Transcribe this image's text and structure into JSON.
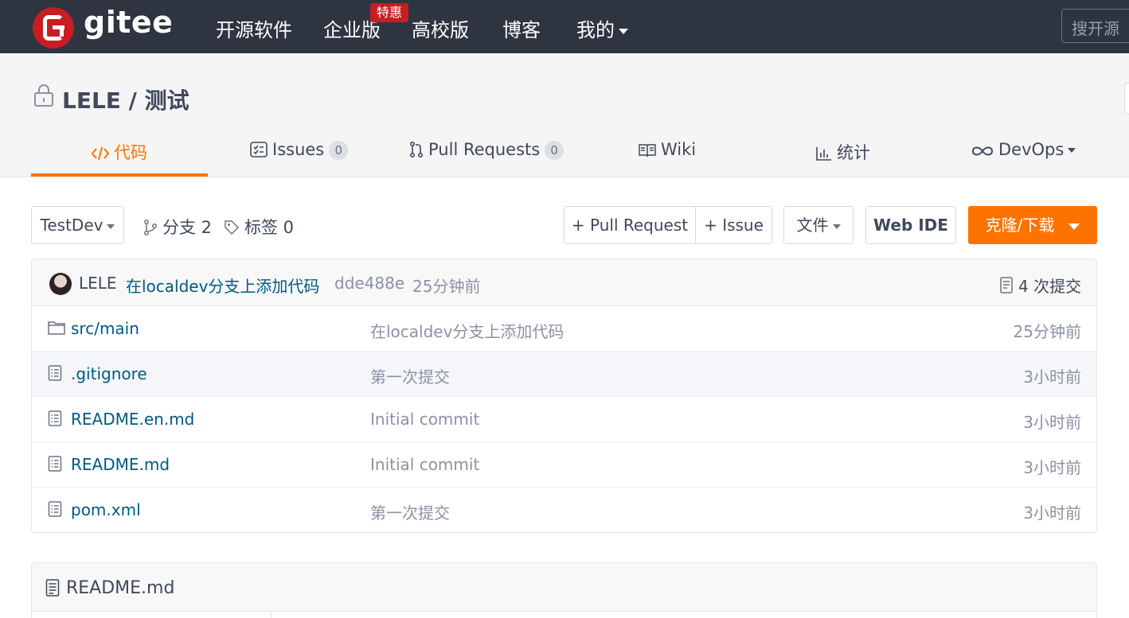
{
  "topnav": {
    "logo_text": "gitee",
    "items": [
      "开源软件",
      "企业版",
      "高校版",
      "博客",
      "我的"
    ],
    "badge": "特惠",
    "search_placeholder": "搜开源"
  },
  "repo": {
    "owner": "LELE",
    "name": "测试",
    "title": "LELE / 测试"
  },
  "tabs": [
    {
      "label": "代码",
      "icon": "code-icon",
      "active": true
    },
    {
      "label": "Issues",
      "icon": "issues-icon",
      "count": "0"
    },
    {
      "label": "Pull Requests",
      "icon": "pull-request-icon",
      "count": "0"
    },
    {
      "label": "Wiki",
      "icon": "book-icon"
    },
    {
      "label": "统计",
      "icon": "bar-chart-icon"
    },
    {
      "label": "DevOps",
      "icon": "infinity-icon"
    }
  ],
  "toolbar": {
    "branch": "TestDev",
    "branches": "分支 2",
    "tags": "标签 0",
    "pull_request": "+ Pull Request",
    "issue": "+ Issue",
    "file": "文件",
    "web_ide": "Web IDE",
    "clone": "克隆/下载"
  },
  "commit": {
    "author": "LELE",
    "message": "在localdev分支上添加代码",
    "hash": "dde488e",
    "time": "25分钟前",
    "count": "4 次提交"
  },
  "files": [
    {
      "name": "src/main",
      "type": "folder",
      "message": "在localdev分支上添加代码",
      "time": "25分钟前"
    },
    {
      "name": ".gitignore",
      "type": "file",
      "message": "第一次提交",
      "time": "3小时前"
    },
    {
      "name": "README.en.md",
      "type": "file",
      "message": "Initial commit",
      "time": "3小时前"
    },
    {
      "name": "README.md",
      "type": "file",
      "message": "Initial commit",
      "time": "3小时前"
    },
    {
      "name": "pom.xml",
      "type": "file",
      "message": "第一次提交",
      "time": "3小时前"
    }
  ],
  "readme": {
    "title": "README.md"
  },
  "colors": {
    "accent": "#fe7300",
    "brand_red": "#c71d23",
    "nav_bg": "#2e3440",
    "link": "#005980"
  }
}
